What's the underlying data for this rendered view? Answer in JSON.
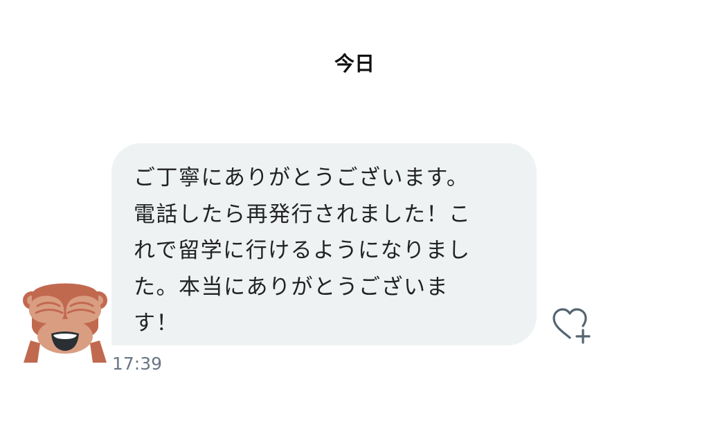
{
  "date_header": "今日",
  "message": {
    "text": "ご丁寧にありがとうございます。\n電話したら再発行されました！こ\nれで留学に行けるようになりまし\nた。本当にありがとうございま\nす！",
    "time": "17:39"
  },
  "icons": {
    "avatar": "see-no-evil-monkey-icon",
    "like": "heart-plus-icon"
  },
  "colors": {
    "bubble_background": "#eef2f3",
    "timestamp": "#687684",
    "like_icon": "#536471",
    "monkey_fur": "#c1694f",
    "monkey_face": "#d99e82"
  }
}
